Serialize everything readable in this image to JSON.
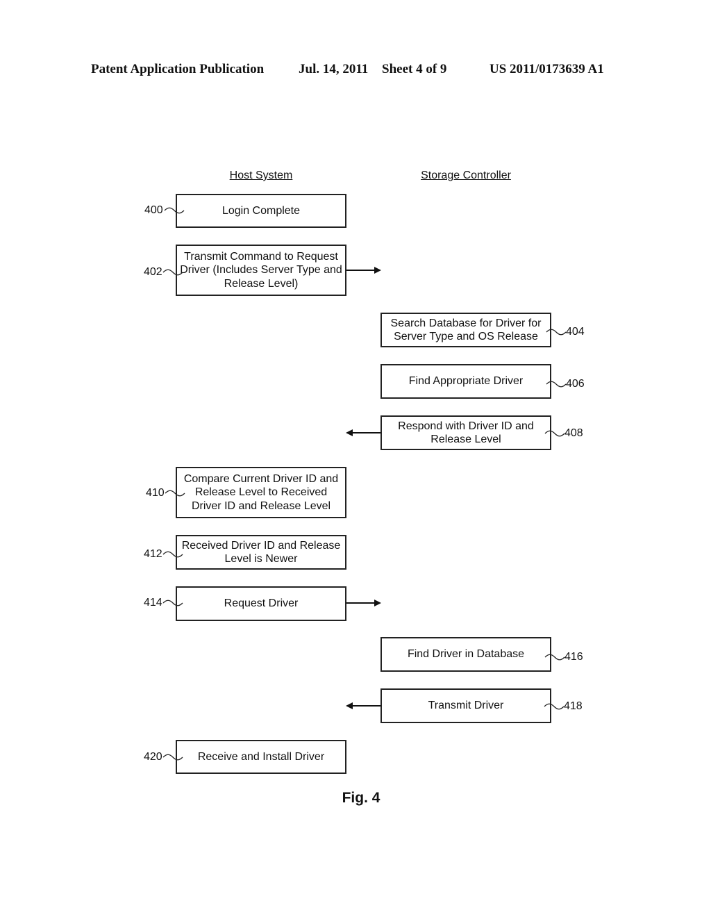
{
  "header": {
    "publication": "Patent Application Publication",
    "date": "Jul. 14, 2011",
    "sheet": "Sheet 4 of 9",
    "number": "US 2011/0173639 A1"
  },
  "columns": {
    "host": "Host System",
    "storage": "Storage Controller"
  },
  "steps": [
    {
      "ref": "400",
      "text": "Login Complete",
      "lane": "host"
    },
    {
      "ref": "402",
      "text": "Transmit Command to Request Driver (Includes Server Type and Release Level)",
      "lane": "host",
      "arrow": "right"
    },
    {
      "ref": "404",
      "text": "Search Database for Driver for Server Type and OS Release",
      "lane": "storage"
    },
    {
      "ref": "406",
      "text": "Find Appropriate Driver",
      "lane": "storage"
    },
    {
      "ref": "408",
      "text": "Respond with Driver ID and Release Level",
      "lane": "storage",
      "arrow": "left"
    },
    {
      "ref": "410",
      "text": "Compare Current Driver ID and Release Level to Received Driver ID and Release Level",
      "lane": "host"
    },
    {
      "ref": "412",
      "text": "Received Driver ID and Release Level is Newer",
      "lane": "host"
    },
    {
      "ref": "414",
      "text": "Request Driver",
      "lane": "host",
      "arrow": "right"
    },
    {
      "ref": "416",
      "text": "Find Driver in Database",
      "lane": "storage"
    },
    {
      "ref": "418",
      "text": "Transmit Driver",
      "lane": "storage",
      "arrow": "left"
    },
    {
      "ref": "420",
      "text": "Receive and Install Driver",
      "lane": "host"
    }
  ],
  "figure_label": "Fig. 4"
}
